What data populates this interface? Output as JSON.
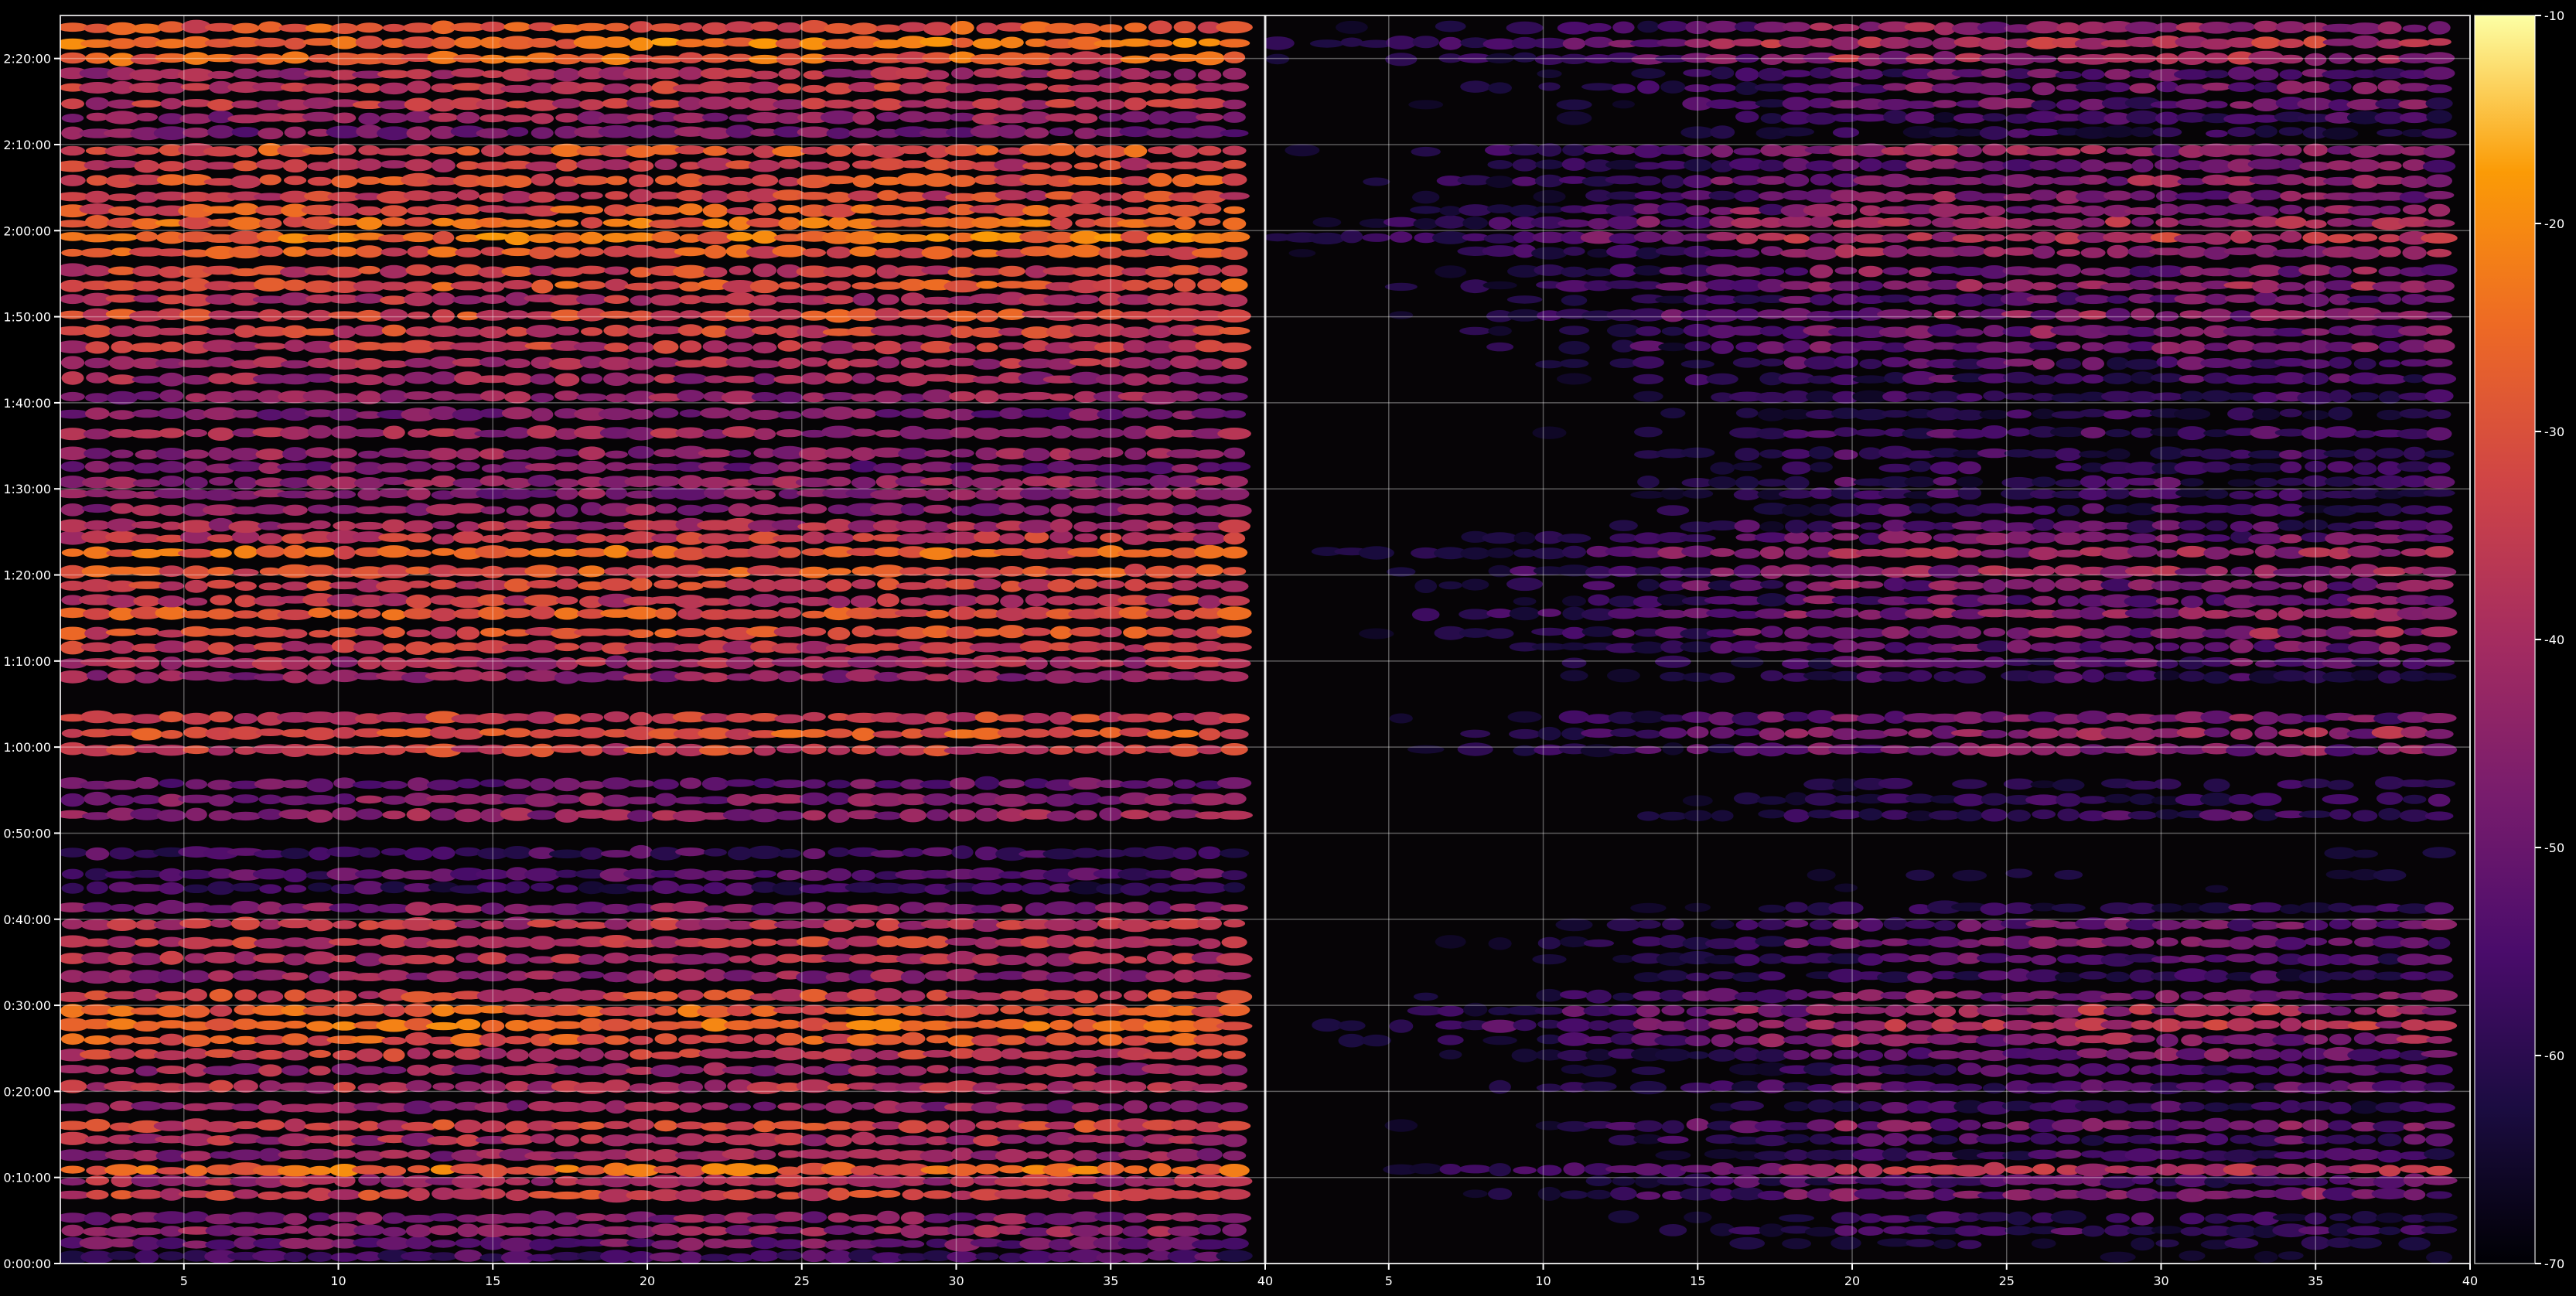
{
  "chart_data": {
    "type": "heatmap",
    "title": "",
    "xlabel": "",
    "ylabel": "",
    "grid": true,
    "colormap": "inferno",
    "colors": {
      "background": "#000000",
      "grid": "#ffffff",
      "axis": "#ffffff",
      "text": "#ffffff"
    },
    "y_ticks": [
      {
        "value": 0,
        "label": "0:00:00"
      },
      {
        "value": 10,
        "label": "0:10:00"
      },
      {
        "value": 20,
        "label": "0:20:00"
      },
      {
        "value": 30,
        "label": "0:30:00"
      },
      {
        "value": 40,
        "label": "0:40:00"
      },
      {
        "value": 50,
        "label": "0:50:00"
      },
      {
        "value": 60,
        "label": "1:00:00"
      },
      {
        "value": 70,
        "label": "1:10:00"
      },
      {
        "value": 80,
        "label": "1:20:00"
      },
      {
        "value": 90,
        "label": "1:30:00"
      },
      {
        "value": 100,
        "label": "1:40:00"
      },
      {
        "value": 110,
        "label": "1:50:00"
      },
      {
        "value": 120,
        "label": "2:00:00"
      },
      {
        "value": 130,
        "label": "2:10:00"
      },
      {
        "value": 140,
        "label": "2:20:00"
      }
    ],
    "y_range_minutes": [
      0,
      145
    ],
    "panels": [
      {
        "x_range": [
          1,
          40
        ],
        "x_ticks": [
          {
            "value": 5,
            "label": "5"
          },
          {
            "value": 10,
            "label": "10"
          },
          {
            "value": 15,
            "label": "15"
          },
          {
            "value": 20,
            "label": "20"
          },
          {
            "value": 25,
            "label": "25"
          },
          {
            "value": 30,
            "label": "30"
          },
          {
            "value": 35,
            "label": "35"
          },
          {
            "value": 40,
            "label": "40"
          }
        ],
        "level_offset_db": 0
      },
      {
        "x_range": [
          1,
          40
        ],
        "x_ticks": [
          {
            "value": 5,
            "label": "5"
          },
          {
            "value": 10,
            "label": "10"
          },
          {
            "value": 15,
            "label": "15"
          },
          {
            "value": 20,
            "label": "20"
          },
          {
            "value": 25,
            "label": "25"
          },
          {
            "value": 30,
            "label": "30"
          },
          {
            "value": 35,
            "label": "35"
          },
          {
            "value": 40,
            "label": "40"
          }
        ],
        "level_offset_db": -14
      }
    ],
    "bands": [
      {
        "t": 0.8,
        "level": -56
      },
      {
        "t": 2.3,
        "level": -50
      },
      {
        "t": 3.8,
        "level": -44
      },
      {
        "t": 5.3,
        "level": -46
      },
      {
        "t": 8.0,
        "level": -34
      },
      {
        "t": 9.6,
        "level": -40
      },
      {
        "t": 10.9,
        "level": -26
      },
      {
        "t": 12.6,
        "level": -44
      },
      {
        "t": 14.4,
        "level": -40
      },
      {
        "t": 16.0,
        "level": -34
      },
      {
        "t": 18.2,
        "level": -44
      },
      {
        "t": 20.5,
        "level": -38
      },
      {
        "t": 22.5,
        "level": -42
      },
      {
        "t": 24.3,
        "level": -36
      },
      {
        "t": 26.0,
        "level": -30
      },
      {
        "t": 27.7,
        "level": -26
      },
      {
        "t": 29.4,
        "level": -28
      },
      {
        "t": 31.1,
        "level": -34
      },
      {
        "t": 33.4,
        "level": -44
      },
      {
        "t": 35.4,
        "level": -40
      },
      {
        "t": 37.3,
        "level": -36
      },
      {
        "t": 39.4,
        "level": -38
      },
      {
        "t": 41.3,
        "level": -46
      },
      {
        "t": 43.6,
        "level": -58
      },
      {
        "t": 45.2,
        "level": -54
      },
      {
        "t": 47.7,
        "level": -56
      },
      {
        "t": 52.1,
        "level": -44
      },
      {
        "t": 53.9,
        "level": -46
      },
      {
        "t": 55.7,
        "level": -50
      },
      {
        "t": 59.7,
        "level": -34
      },
      {
        "t": 61.6,
        "level": -30
      },
      {
        "t": 63.4,
        "level": -34
      },
      {
        "t": 68.2,
        "level": -44
      },
      {
        "t": 69.8,
        "level": -40
      },
      {
        "t": 71.6,
        "level": -36
      },
      {
        "t": 73.3,
        "level": -32
      },
      {
        "t": 75.5,
        "level": -30
      },
      {
        "t": 77.0,
        "level": -36
      },
      {
        "t": 78.8,
        "level": -34
      },
      {
        "t": 80.4,
        "level": -30
      },
      {
        "t": 82.6,
        "level": -28
      },
      {
        "t": 84.3,
        "level": -36
      },
      {
        "t": 85.7,
        "level": -40
      },
      {
        "t": 87.6,
        "level": -44
      },
      {
        "t": 89.4,
        "level": -46
      },
      {
        "t": 90.8,
        "level": -44
      },
      {
        "t": 92.5,
        "level": -48
      },
      {
        "t": 94.1,
        "level": -44
      },
      {
        "t": 96.5,
        "level": -42
      },
      {
        "t": 98.7,
        "level": -48
      },
      {
        "t": 100.7,
        "level": -44
      },
      {
        "t": 102.8,
        "level": -42
      },
      {
        "t": 104.6,
        "level": -40
      },
      {
        "t": 106.5,
        "level": -36
      },
      {
        "t": 108.3,
        "level": -34
      },
      {
        "t": 110.2,
        "level": -32
      },
      {
        "t": 112.0,
        "level": -38
      },
      {
        "t": 113.6,
        "level": -30
      },
      {
        "t": 115.3,
        "level": -34
      },
      {
        "t": 117.5,
        "level": -30
      },
      {
        "t": 119.2,
        "level": -24
      },
      {
        "t": 120.9,
        "level": -26
      },
      {
        "t": 122.4,
        "level": -30
      },
      {
        "t": 124.0,
        "level": -34
      },
      {
        "t": 125.8,
        "level": -30
      },
      {
        "t": 127.6,
        "level": -36
      },
      {
        "t": 129.3,
        "level": -30
      },
      {
        "t": 131.4,
        "level": -48
      },
      {
        "t": 133.1,
        "level": -44
      },
      {
        "t": 134.7,
        "level": -38
      },
      {
        "t": 136.6,
        "level": -36
      },
      {
        "t": 138.2,
        "level": -40
      },
      {
        "t": 140.0,
        "level": -28
      },
      {
        "t": 141.8,
        "level": -24
      },
      {
        "t": 143.6,
        "level": -30
      }
    ],
    "colorbar": {
      "range": [
        -70,
        -10
      ],
      "ticks": [
        {
          "value": -10,
          "label": "-10"
        },
        {
          "value": -20,
          "label": "-20"
        },
        {
          "value": -30,
          "label": "-30"
        },
        {
          "value": -40,
          "label": "-40"
        },
        {
          "value": -50,
          "label": "-50"
        },
        {
          "value": -60,
          "label": "-60"
        },
        {
          "value": -70,
          "label": "-70"
        }
      ]
    }
  }
}
